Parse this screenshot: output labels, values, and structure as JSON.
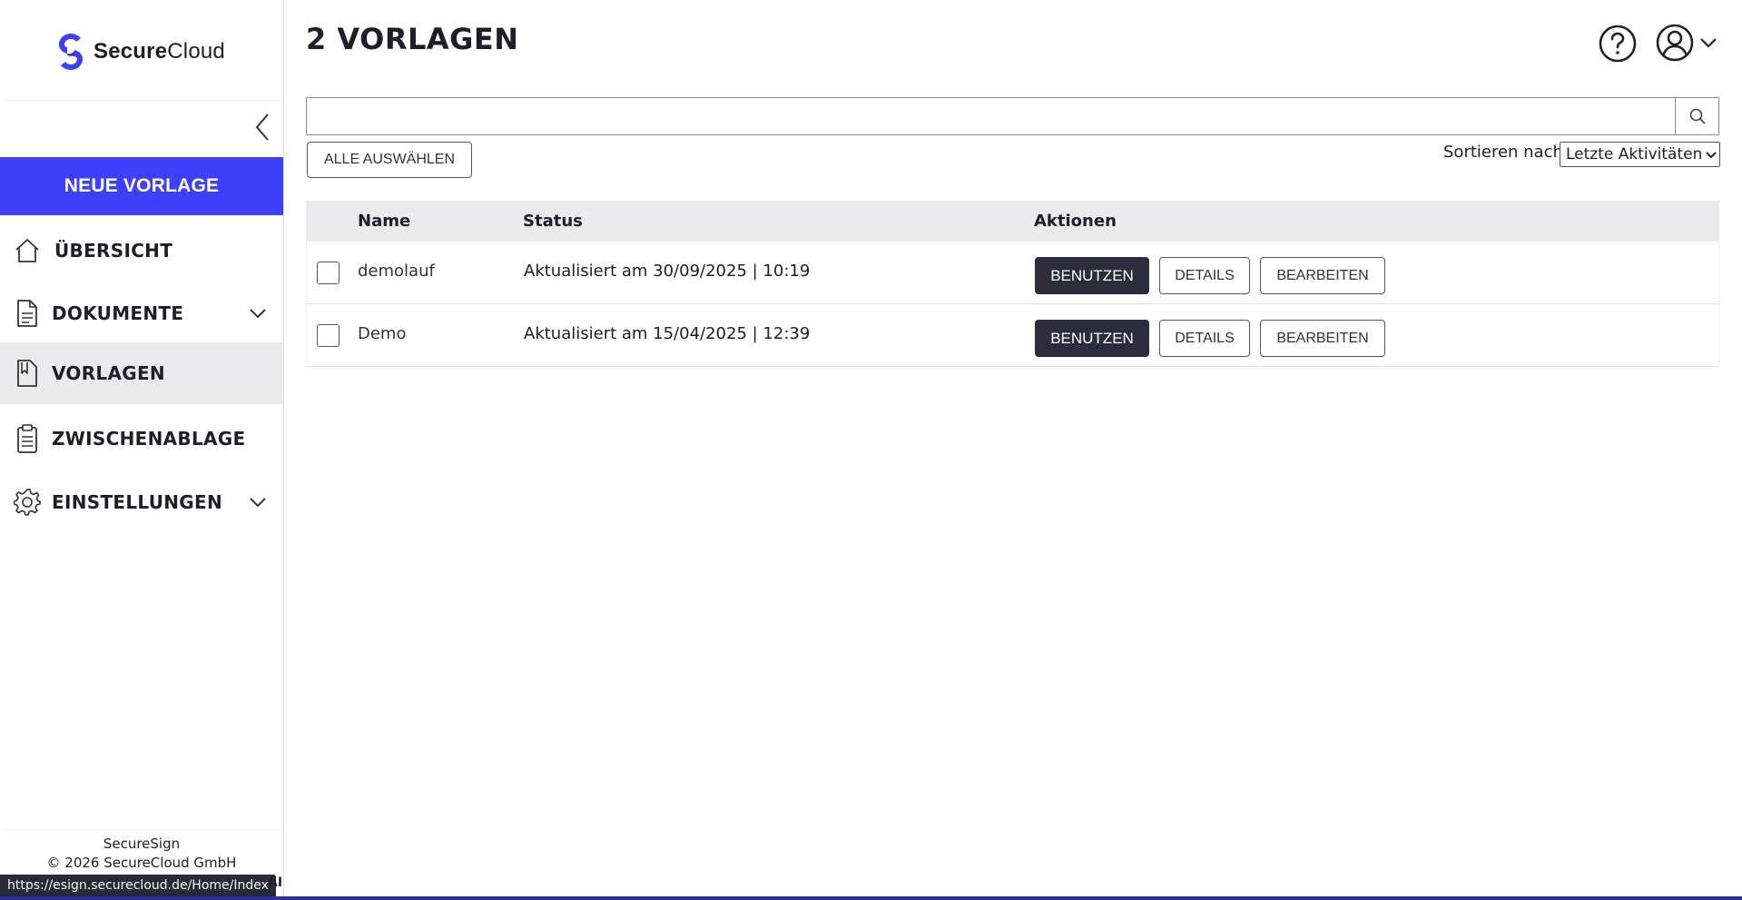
{
  "brand": {
    "name_bold": "Secure",
    "name_regular": "Cloud",
    "logo_color": "#3d3ff9"
  },
  "sidebar": {
    "new_button_label": "NEUE VORLAGE",
    "items": [
      {
        "label": "ÜBERSICHT",
        "icon": "home-icon",
        "expandable": false,
        "active": false
      },
      {
        "label": "DOKUMENTE",
        "icon": "document-icon",
        "expandable": true,
        "active": false
      },
      {
        "label": "VORLAGEN",
        "icon": "template-bookmark-icon",
        "expandable": false,
        "active": true
      },
      {
        "label": "ZWISCHENABLAGE",
        "icon": "clipboard-icon",
        "expandable": false,
        "active": false
      },
      {
        "label": "EINSTELLUNGEN",
        "icon": "gear-icon",
        "expandable": true,
        "active": false
      }
    ],
    "footer_app": "SecureSign",
    "footer_copyright": "© 2026 SecureCloud GmbH"
  },
  "header": {
    "title": "2 VORLAGEN"
  },
  "search": {
    "value": "",
    "placeholder": ""
  },
  "toolbar": {
    "select_all_label": "ALLE AUSWÄHLEN",
    "sort_label": "Sortieren nach:",
    "sort_selected": "Letzte Aktivitäten"
  },
  "table": {
    "columns": [
      "Name",
      "Status",
      "Aktionen"
    ],
    "rows": [
      {
        "name": "demolauf",
        "status": "Aktualisiert am 30/09/2025 | 10:19",
        "checked": false
      },
      {
        "name": "Demo",
        "status": "Aktualisiert am 15/04/2025 | 12:39",
        "checked": false
      }
    ],
    "actions": {
      "use_label": "BENUTZEN",
      "details_label": "DETAILS",
      "edit_label": "BEARBEITEN"
    }
  },
  "statusbar": {
    "url": "https://esign.securecloud.de/Home/Index",
    "trailing_text": "AI"
  },
  "colors": {
    "accent": "#3d3ff9",
    "dark_button": "#2c2c3d",
    "active_nav_bg": "#ebebed"
  }
}
